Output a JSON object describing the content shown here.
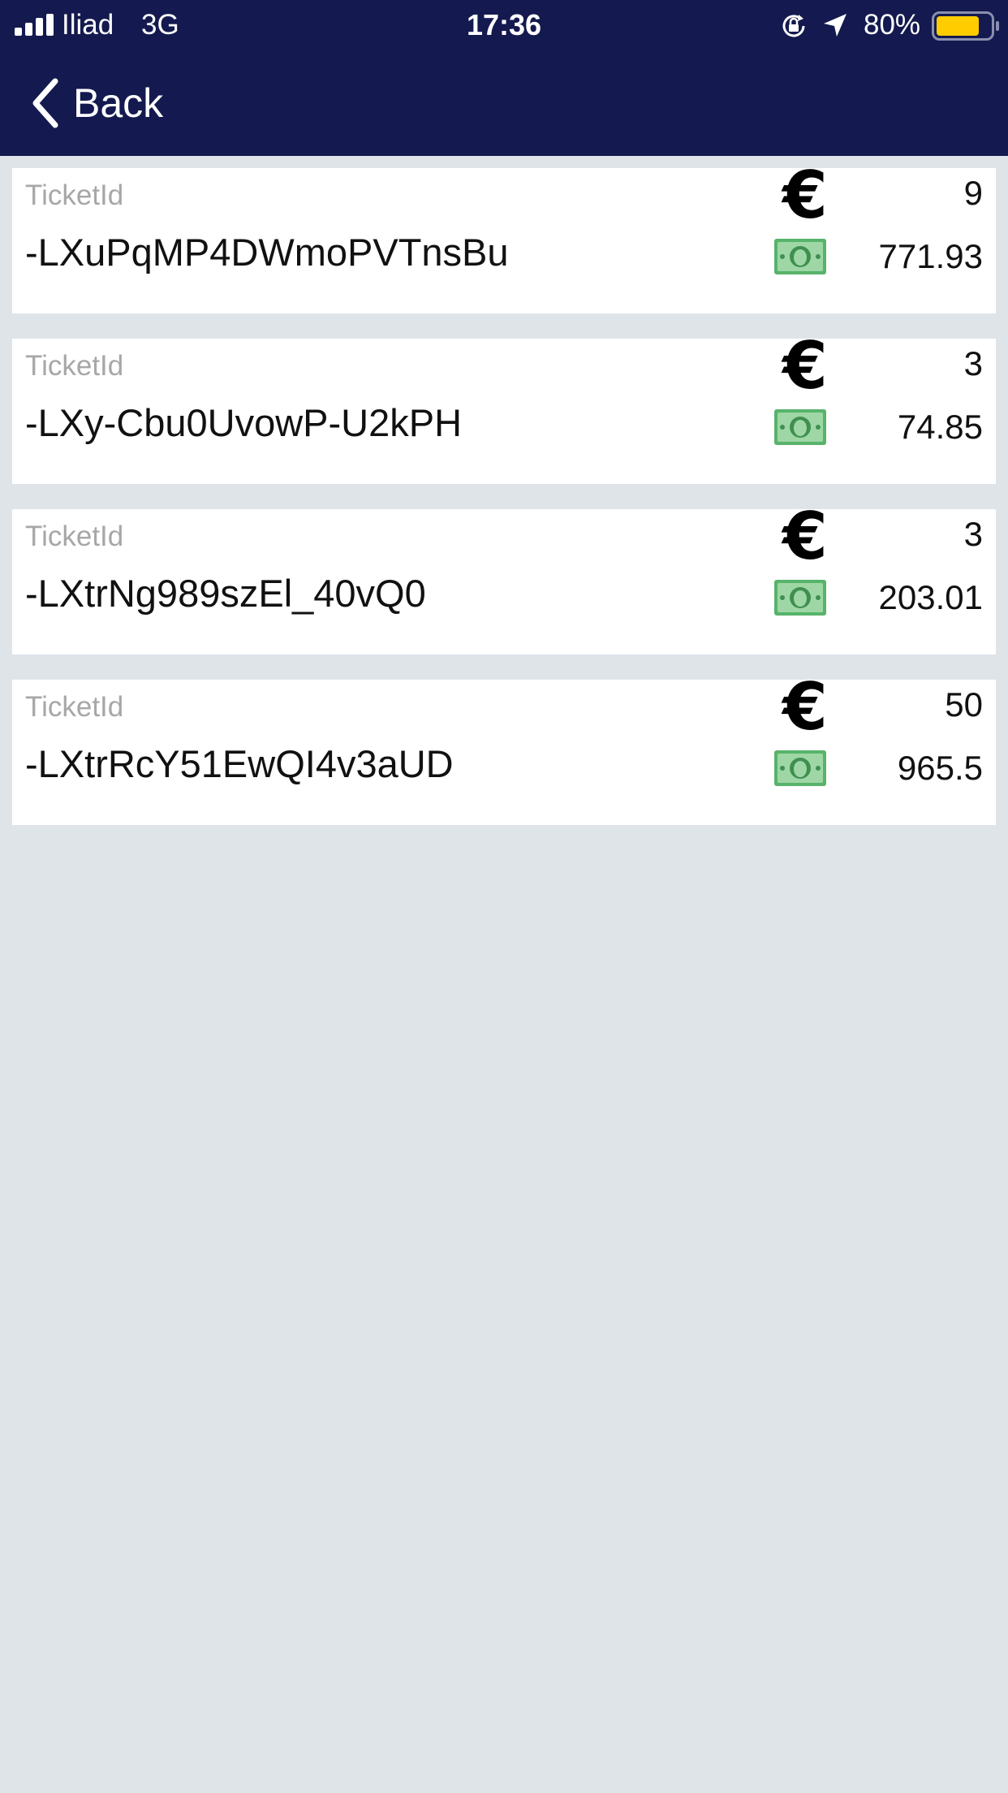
{
  "status_bar": {
    "carrier": "Iliad",
    "network": "3G",
    "time": "17:36",
    "battery_percent": "80%",
    "battery_level": 0.8,
    "battery_color": "#ffcc00",
    "icons": [
      "signal-icon",
      "orientation-lock-icon",
      "location-icon",
      "battery-icon"
    ]
  },
  "nav": {
    "back_label": "Back",
    "background": "#141a4f"
  },
  "tickets": [
    {
      "caption": "TicketId",
      "id": "-LXuPqMP4DWmoPVTnsBu",
      "count": "9",
      "amount": "771.93"
    },
    {
      "caption": "TicketId",
      "id": "-LXy-Cbu0UvowP-U2kPH",
      "count": "3",
      "amount": "74.85"
    },
    {
      "caption": "TicketId",
      "id": "-LXtrNg989szEl_40vQ0",
      "count": "3",
      "amount": "203.01"
    },
    {
      "caption": "TicketId",
      "id": "-LXtrRcY51EwQI4v3aUD",
      "count": "50",
      "amount": "965.5"
    }
  ],
  "ticket_icons": {
    "count_icon": "euro-icon",
    "amount_icon": "money-icon"
  }
}
